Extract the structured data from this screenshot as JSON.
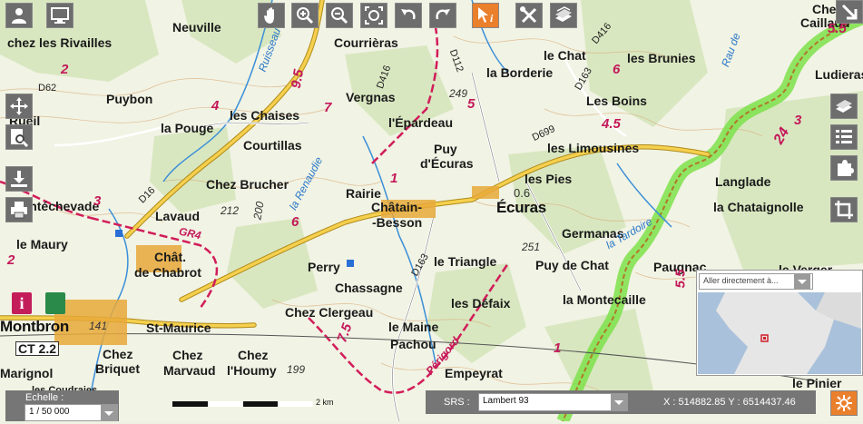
{
  "toolbar": {
    "top_buttons": [
      {
        "name": "user-icon",
        "label": "user"
      },
      {
        "name": "monitor-icon",
        "label": "monitor"
      },
      {
        "name": "pan-hand-icon",
        "label": "pan"
      },
      {
        "name": "zoom-in-icon",
        "label": "zoom in"
      },
      {
        "name": "zoom-out-icon",
        "label": "zoom out"
      },
      {
        "name": "zoom-extent-icon",
        "label": "full extent"
      },
      {
        "name": "undo-icon",
        "label": "undo"
      },
      {
        "name": "redo-icon",
        "label": "redo"
      },
      {
        "name": "info-cursor-icon",
        "label": "info"
      },
      {
        "name": "tools-icon",
        "label": "tools"
      },
      {
        "name": "layers-icon",
        "label": "layers"
      }
    ]
  },
  "map": {
    "place_labels": [
      {
        "text": "Chez",
        "cls": "big"
      },
      {
        "text": "Caillaud",
        "cls": "big"
      },
      {
        "text": "Neuville",
        "cls": "big"
      },
      {
        "text": "Courrièras",
        "cls": "big"
      },
      {
        "text": "chez les Rivailles",
        "cls": "big"
      },
      {
        "text": "Puybon",
        "cls": "big"
      },
      {
        "text": "la Borderie",
        "cls": "big"
      },
      {
        "text": "le Chat",
        "cls": "big"
      },
      {
        "text": "les Brunies",
        "cls": "big"
      },
      {
        "text": "Ludieras",
        "cls": "big"
      },
      {
        "text": "Vergnas",
        "cls": "big"
      },
      {
        "text": "Les Boins",
        "cls": "big"
      },
      {
        "text": "l'Épardeau",
        "cls": "big"
      },
      {
        "text": "les Chaises",
        "cls": "big"
      },
      {
        "text": "la Pouge",
        "cls": "big"
      },
      {
        "text": "Courtillas",
        "cls": "big"
      },
      {
        "text": "Puy",
        "cls": "big"
      },
      {
        "text": "d'Écuras",
        "cls": "big"
      },
      {
        "text": "les Limousines",
        "cls": "big"
      },
      {
        "text": "Chez Brucher",
        "cls": "big"
      },
      {
        "text": "Rairie",
        "cls": "big"
      },
      {
        "text": "les Pies",
        "cls": "big"
      },
      {
        "text": "Écuras",
        "cls": "town"
      },
      {
        "text": "Langlade",
        "cls": "big"
      },
      {
        "text": "la Chataignolle",
        "cls": "big"
      },
      {
        "text": "Lavaud",
        "cls": "big"
      },
      {
        "text": "Montéchevade",
        "cls": "big"
      },
      {
        "text": "Châtain-",
        "cls": "big"
      },
      {
        "text": "-Besson",
        "cls": "big"
      },
      {
        "text": "Germanas",
        "cls": "big"
      },
      {
        "text": "le Maury",
        "cls": "big"
      },
      {
        "text": "Chât.",
        "cls": "big"
      },
      {
        "text": "de Chabrot",
        "cls": "big"
      },
      {
        "text": "Perry",
        "cls": "big"
      },
      {
        "text": "le Triangle",
        "cls": "big"
      },
      {
        "text": "Puy de Chat",
        "cls": "big"
      },
      {
        "text": "Paugnac",
        "cls": "big"
      },
      {
        "text": "le Verger",
        "cls": "big"
      },
      {
        "text": "Chassagne",
        "cls": "big"
      },
      {
        "text": "les Défaix",
        "cls": "big"
      },
      {
        "text": "la Montecaille",
        "cls": "big"
      },
      {
        "text": "Montbron",
        "cls": "town"
      },
      {
        "text": "St-Maurice",
        "cls": "big"
      },
      {
        "text": "Chez Clergeau",
        "cls": "big"
      },
      {
        "text": "le Maine",
        "cls": "big"
      },
      {
        "text": "Pachou",
        "cls": "big"
      },
      {
        "text": "CT 2.2",
        "cls": "big"
      },
      {
        "text": "Chez",
        "cls": "big"
      },
      {
        "text": "Briquet",
        "cls": "big"
      },
      {
        "text": "Chez",
        "cls": "big"
      },
      {
        "text": "Marvaud",
        "cls": "big"
      },
      {
        "text": "Chez",
        "cls": "big"
      },
      {
        "text": "l'Houmy",
        "cls": "big"
      },
      {
        "text": "Empeyrat",
        "cls": "big"
      },
      {
        "text": "le Pinier",
        "cls": "big"
      },
      {
        "text": "Marignol",
        "cls": "big"
      },
      {
        "text": "Rueil",
        "cls": "big"
      },
      {
        "text": "les Coudraies",
        "cls": "big"
      }
    ],
    "roads": [
      "D416",
      "D112",
      "D62",
      "D163",
      "D699",
      "D16",
      "D163",
      "D416"
    ],
    "altitudes": [
      "249",
      "212",
      "200",
      "251",
      "199",
      "141",
      "0.6"
    ],
    "gr_labels": [
      "GR4",
      "Périgord"
    ],
    "water_labels": [
      "Ruisseau",
      "la Renaudie",
      "la Tardoire",
      "Rau de"
    ],
    "trail_numbers": [
      "9.5",
      "2",
      "7",
      "6",
      "4.5",
      "24",
      "3",
      "1",
      "7.5",
      "5",
      "5.5",
      "6",
      "3",
      "4",
      "1",
      "5.5",
      "2"
    ]
  },
  "right_panel": {
    "buttons": [
      {
        "name": "layers-panel-icon"
      },
      {
        "name": "legend-list-icon"
      },
      {
        "name": "puzzle-icon"
      },
      {
        "name": "crop-icon"
      }
    ]
  },
  "left_panel": {
    "buttons": [
      {
        "name": "move-arrows-icon"
      },
      {
        "name": "search-document-icon"
      },
      {
        "name": "download-icon"
      },
      {
        "name": "print-icon"
      }
    ]
  },
  "overview": {
    "goto_placeholder": "Aller directement à..."
  },
  "footer": {
    "scale_label": "Echelle :",
    "scale_value": "1 / 50 000",
    "scalebar_text": "2 km",
    "srs_label": "SRS :",
    "srs_value": "Lambert 93",
    "coords": "X : 514882.85 Y : 6514437.46"
  },
  "colors": {
    "toolbar_bg": "#6d6d6d",
    "accent_orange": "#ea7f2c",
    "road_yellow": "#f2c84b",
    "gr_red": "#d21d5a",
    "forest_green": "#cfe2b5",
    "river_blue": "#3b8fd8"
  }
}
